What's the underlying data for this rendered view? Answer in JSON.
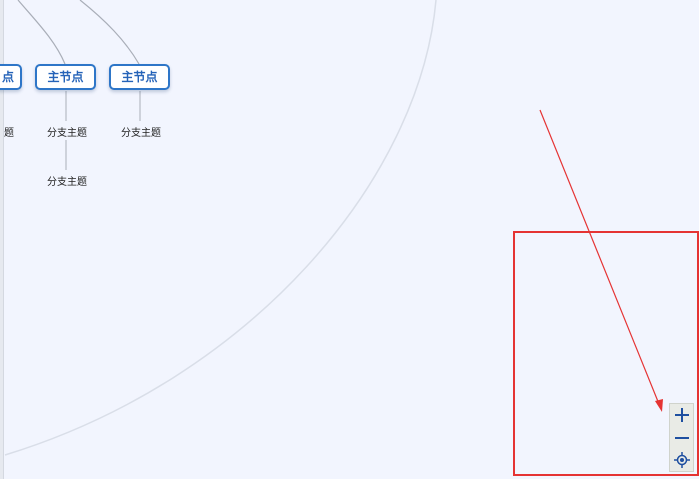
{
  "mindmap": {
    "main_nodes": [
      {
        "label": "点"
      },
      {
        "label": "主节点"
      },
      {
        "label": "主节点"
      }
    ],
    "branches": [
      {
        "label": "题"
      },
      {
        "label": "分支主题"
      },
      {
        "label": "分支主题"
      },
      {
        "label": "分支主题"
      }
    ]
  },
  "zoom_controls": {
    "zoom_in_icon": "plus-icon",
    "zoom_out_icon": "minus-icon",
    "locate_icon": "crosshair-icon"
  },
  "colors": {
    "canvas_bg": "#f2f5fe",
    "node_border": "#2e76c8",
    "node_text": "#2563b8",
    "annotation_red": "#e53333"
  }
}
